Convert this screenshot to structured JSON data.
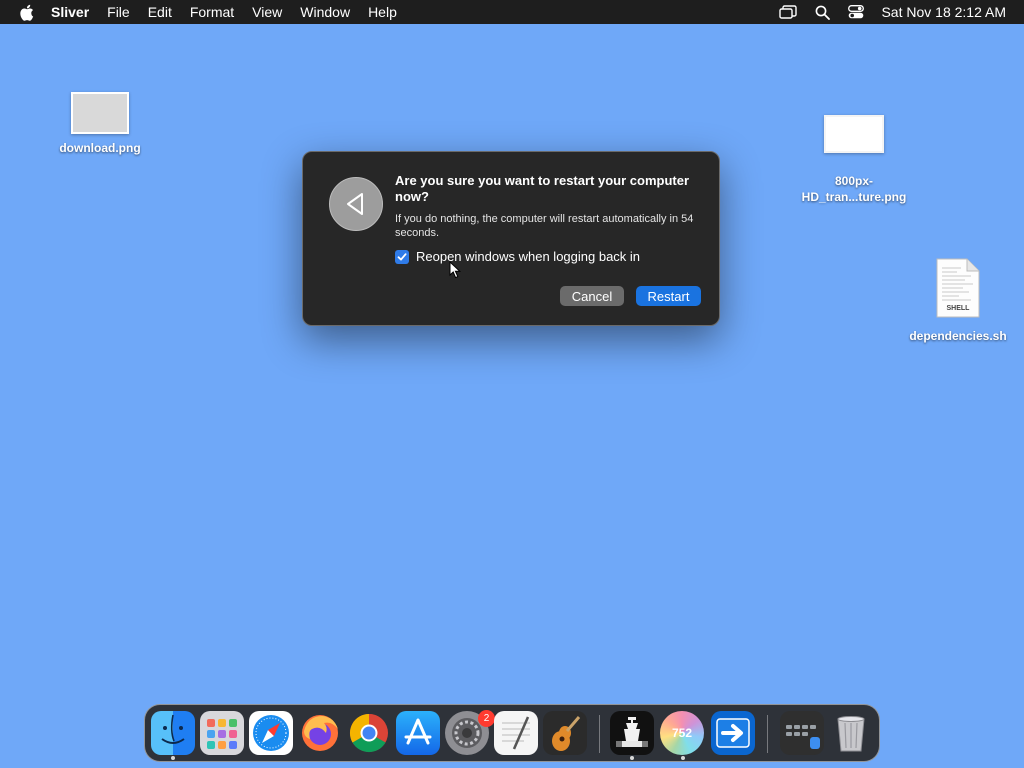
{
  "menubar": {
    "app_name": "Sliver",
    "items": [
      "File",
      "Edit",
      "Format",
      "View",
      "Window",
      "Help"
    ],
    "clock": "Sat Nov 18  2:12 AM"
  },
  "desktop": {
    "icons": [
      {
        "label": "download.png"
      },
      {
        "label_line1": "800px-",
        "label_line2": "HD_tran...ture.png"
      },
      {
        "label": "dependencies.sh",
        "badge_text": "SHELL"
      }
    ]
  },
  "dialog": {
    "title": "Are you sure you want to restart your computer now?",
    "message": "If you do nothing, the computer will restart automatically in 54 seconds.",
    "checkbox_label": "Reopen windows when logging back in",
    "checkbox_checked": true,
    "cancel_label": "Cancel",
    "restart_label": "Restart"
  },
  "dock": {
    "apps": [
      "finder",
      "launchpad",
      "safari",
      "firefox",
      "chrome",
      "app-store",
      "system-settings",
      "textedit",
      "garageband",
      "chess",
      "752",
      "migration-assistant",
      "screen-apps",
      "trash"
    ],
    "system_settings_badge": "2",
    "counter_text": "752"
  },
  "colors": {
    "desktop": "#6fa8f8",
    "accent": "#1a73e0"
  }
}
